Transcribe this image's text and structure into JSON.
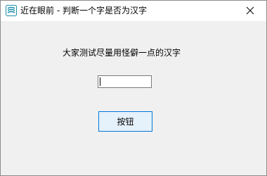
{
  "window": {
    "title": "近在眼前 - 判断一个字是否为汉字",
    "app_icon": "app-logo-icon",
    "close_icon": "close-icon"
  },
  "main": {
    "prompt_label": "大家测试尽量用怪僻一点的汉字",
    "input": {
      "value": "",
      "placeholder": ""
    },
    "button_label": "按钮"
  },
  "colors": {
    "title_bg": "#ffffff",
    "client_bg": "#f0f0f0",
    "button_bg": "#e5f1fb",
    "button_border": "#0078d7",
    "icon_accent": "#1f8fa8"
  }
}
